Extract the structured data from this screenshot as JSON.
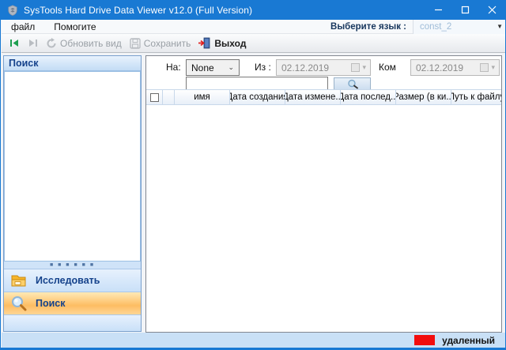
{
  "window": {
    "title": "SysTools Hard Drive Data Viewer v12.0 (Full Version)"
  },
  "menu": {
    "items": [
      {
        "label": "файл"
      },
      {
        "label": "Помогите"
      }
    ],
    "language": {
      "label": "Выберите язык :",
      "value": "const_2"
    }
  },
  "toolbar": {
    "refresh_label": "Обновить вид",
    "save_label": "Сохранить",
    "exit_label": "Выход"
  },
  "left_panel": {
    "header": "Поиск",
    "buttons": [
      {
        "label": "Исследовать",
        "icon": "folder-icon",
        "selected": false
      },
      {
        "label": "Поиск",
        "icon": "magnifier-icon",
        "selected": true
      }
    ]
  },
  "search_panel": {
    "on_label": "На:",
    "on_value": "None",
    "from_label": "Из :",
    "from_value": "02.12.2019",
    "to_label": "Ком",
    "to_value": "02.12.2019",
    "query_value": ""
  },
  "table": {
    "columns": [
      "",
      "",
      "имя",
      "Дата создания",
      "Дата измене...",
      "Дата послед...",
      "Размер (в ки...",
      "Путь к файлу"
    ],
    "rows": []
  },
  "status_bar": {
    "legend_label": "удаленный",
    "legend_color": "#f20d0d"
  },
  "colors": {
    "titlebar": "#1979d3",
    "selected_button": "#fdbd63",
    "panel_header_text": "#15428b"
  }
}
